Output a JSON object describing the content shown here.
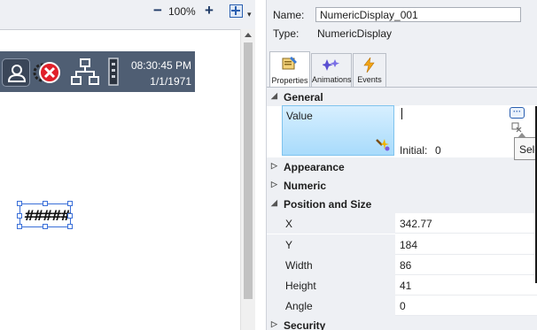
{
  "toolbar": {
    "zoom_out_label": "−",
    "zoom_value": "100%",
    "zoom_in_label": "+",
    "fit_icon": "fit-to-screen-icon",
    "menu_caret": "▾"
  },
  "hmi_header": {
    "user_icon": "user-icon",
    "settings_error_icon": "gear-error-icon",
    "network_icon": "network-icon",
    "device_icon": "device-icon",
    "time": "08:30:45 PM",
    "date": "1/1/1971",
    "background": "#4f5e73"
  },
  "numeric_object": {
    "display_text": "#####"
  },
  "properties": {
    "name_label": "Name:",
    "name_value": "NumericDisplay_001",
    "type_label": "Type:",
    "type_value": "NumericDisplay",
    "tabs": [
      {
        "label": "Properties",
        "icon": "properties-icon",
        "active": true
      },
      {
        "label": "Animations",
        "icon": "animations-icon",
        "active": false
      },
      {
        "label": "Events",
        "icon": "events-icon",
        "active": false
      }
    ],
    "categories": {
      "general": "General",
      "appearance": "Appearance",
      "numeric": "Numeric",
      "position_size": "Position and Size",
      "security": "Security"
    },
    "value_row": {
      "label": "Value",
      "value": "",
      "browse_label": "···",
      "initial_label": "Initial:",
      "initial_value": "0"
    },
    "position_rows": [
      {
        "label": "X",
        "value": "342.77"
      },
      {
        "label": "Y",
        "value": "184"
      },
      {
        "label": "Width",
        "value": "86"
      },
      {
        "label": "Height",
        "value": "41"
      },
      {
        "label": "Angle",
        "value": "0"
      }
    ],
    "tooltip": "Sele"
  },
  "colors": {
    "accent": "#2a5fb0",
    "selection": "#a8dbfb",
    "error": "#e0202a"
  }
}
